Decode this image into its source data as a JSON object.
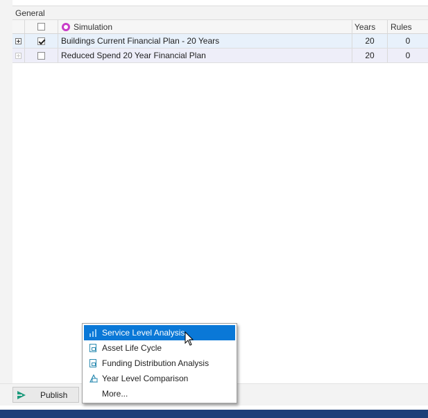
{
  "grid": {
    "group_header": "General",
    "columns": {
      "simulation": "Simulation",
      "years": "Years",
      "rules": "Rules"
    },
    "rows": [
      {
        "name": "Buildings Current Financial Plan - 20 Years",
        "years": "20",
        "rules": "0",
        "checked": true
      },
      {
        "name": "Reduced Spend 20 Year Financial Plan",
        "years": "20",
        "rules": "0",
        "checked": false
      }
    ]
  },
  "toolbar": {
    "publish_label": "Publish"
  },
  "context_menu": {
    "items": [
      {
        "label": "Service Level Analysis",
        "icon": "chart-icon",
        "active": true
      },
      {
        "label": "Asset Life Cycle",
        "icon": "document-icon"
      },
      {
        "label": "Funding Distribution Analysis",
        "icon": "document-icon"
      },
      {
        "label": "Year Level Comparison",
        "icon": "compare-icon"
      },
      {
        "label": "More...",
        "icon": ""
      }
    ]
  },
  "colors": {
    "menu_highlight": "#0a78d7",
    "status_bar": "#1e3f78",
    "simulation_icon": "#c83cc8",
    "publish_icon": "#1b9a7c"
  }
}
